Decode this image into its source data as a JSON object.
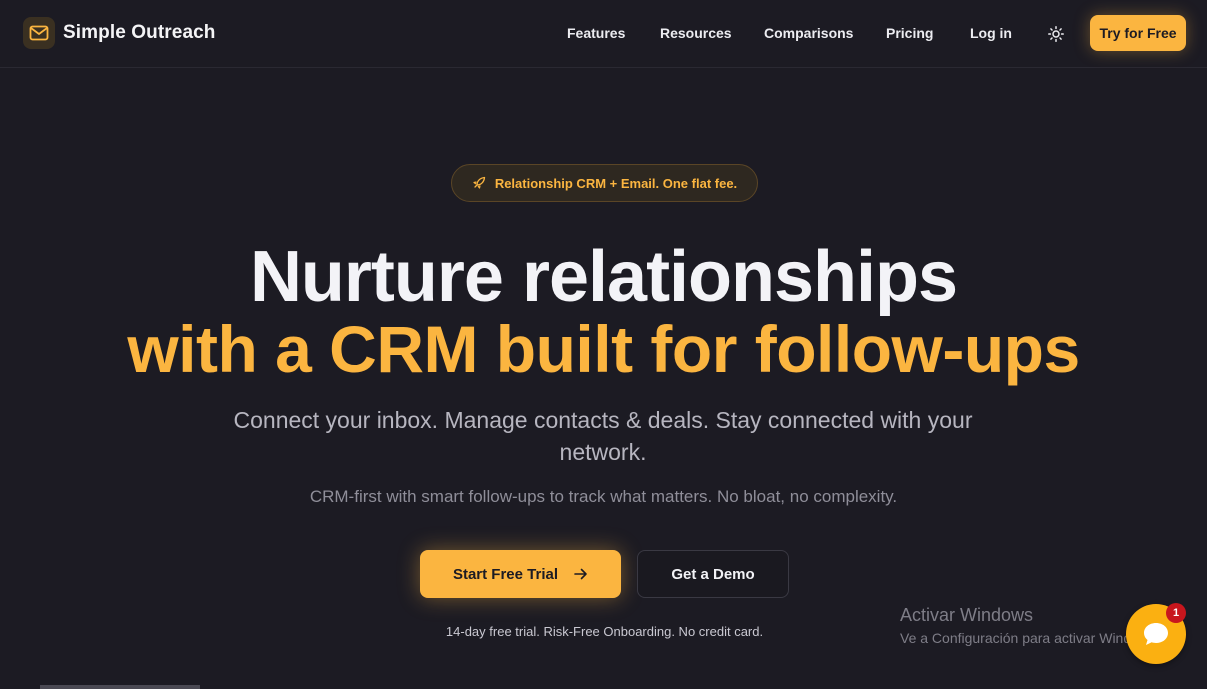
{
  "header": {
    "brand_name": "Simple Outreach",
    "nav": {
      "features": "Features",
      "resources": "Resources",
      "comparisons": "Comparisons",
      "pricing": "Pricing",
      "login": "Log in"
    },
    "cta_label": "Try for Free"
  },
  "hero": {
    "badge": "Relationship CRM + Email. One flat fee.",
    "headline_line1": "Nurture relationships",
    "headline_line2": "with a CRM built for follow-ups",
    "subheading": "Connect your inbox. Manage contacts & deals. Stay connected with your network.",
    "tagline": "CRM-first with smart follow-ups to track what matters. No bloat, no complexity.",
    "primary_cta": "Start Free Trial",
    "secondary_cta": "Get a Demo",
    "fineprint": "14-day free trial. Risk-Free Onboarding. No credit card."
  },
  "watermark": {
    "title": "Activar Windows",
    "subtitle": "Ve a Configuración para activar Windows."
  },
  "chat": {
    "unread_count": "1"
  },
  "colors": {
    "background": "#1c1b23",
    "accent": "#fbb540",
    "heading": "#f3f3f7",
    "muted": "#b7b6c0",
    "badge_red": "#c8161d"
  },
  "icons": {
    "brand": "mail-icon",
    "badge": "rocket-icon",
    "theme": "sun-icon",
    "cta": "arrow-right-icon",
    "chat": "chat-bubble-icon"
  }
}
